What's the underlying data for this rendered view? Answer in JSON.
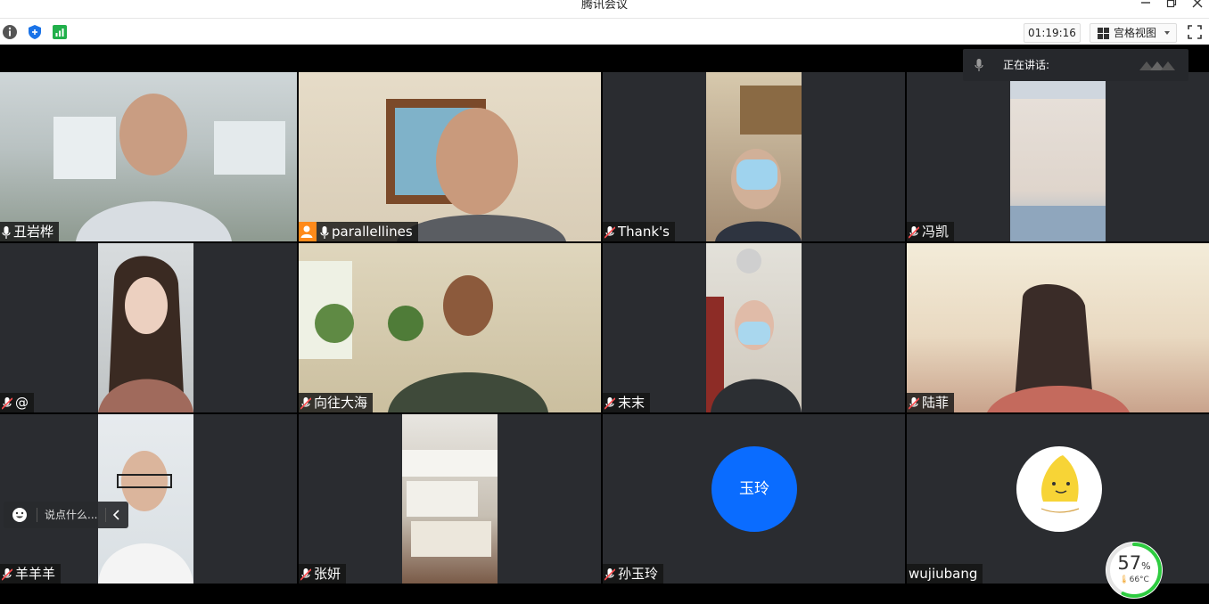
{
  "window": {
    "title": "腾讯会议"
  },
  "toolbar": {
    "timer": "01:19:16",
    "view_label": "宫格视图"
  },
  "speaking": {
    "label": "正在讲话:"
  },
  "participants": [
    {
      "name": "丑岩桦",
      "muted": false
    },
    {
      "name": "parallellines",
      "muted": false,
      "host": true
    },
    {
      "name": "Thank's",
      "muted": true
    },
    {
      "name": "冯凯",
      "muted": true
    },
    {
      "name": "@",
      "muted": true
    },
    {
      "name": "向往大海",
      "muted": true
    },
    {
      "name": "末末",
      "muted": true
    },
    {
      "name": "陆菲",
      "muted": true
    },
    {
      "name": "羊羊羊",
      "muted": true
    },
    {
      "name": "张妍",
      "muted": true
    },
    {
      "name": "孙玉玲",
      "muted": true,
      "avatar_text": "玉玲"
    },
    {
      "name": "wujiubang",
      "muted": false
    }
  ],
  "chat": {
    "placeholder": "说点什么..."
  },
  "performance": {
    "cpu_percent": "57",
    "percent_sign": "%",
    "temperature": "66°C"
  },
  "colors": {
    "accent": "#0a6cff",
    "host_badge": "#ff8a1a",
    "gauge": "#2ecc40"
  }
}
